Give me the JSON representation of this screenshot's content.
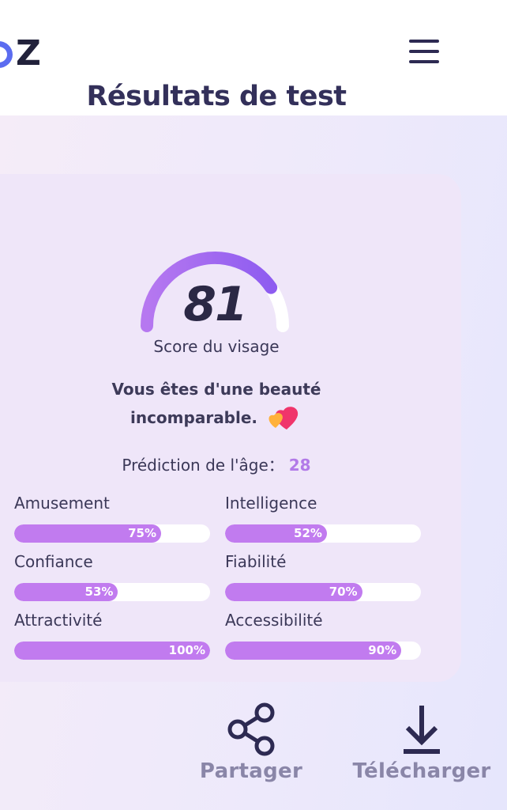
{
  "header": {
    "logo_text": "Z",
    "menu_icon": "hamburger-menu-icon"
  },
  "result": {
    "title": "Résultats de test",
    "score": "81",
    "score_value": 81,
    "score_label": "Score du visage",
    "message_line1": "Vous êtes d'une beauté",
    "message_line2": "incomparable.",
    "message_emoji": "two-hearts-emoji",
    "age_label": "Prédiction de l'âge：",
    "age_value": "28"
  },
  "metrics": [
    {
      "label": "Amusement",
      "value": 75,
      "text": "75%"
    },
    {
      "label": "Intelligence",
      "value": 52,
      "text": "52%"
    },
    {
      "label": "Confiance",
      "value": 53,
      "text": "53%"
    },
    {
      "label": "Fiabilité",
      "value": 70,
      "text": "70%"
    },
    {
      "label": "Attractivité",
      "value": 100,
      "text": "100%"
    },
    {
      "label": "Accessibilité",
      "value": 90,
      "text": "90%"
    }
  ],
  "actions": {
    "share_label": "Partager",
    "share_icon": "share-icon",
    "download_label": "Télécharger",
    "download_icon": "download-icon"
  },
  "colors": {
    "accent": "#c17bef",
    "gauge_start": "#b074f0",
    "gauge_end": "#8f5cf0",
    "age_value": "#b27ae8",
    "text_dark": "#33305a"
  }
}
